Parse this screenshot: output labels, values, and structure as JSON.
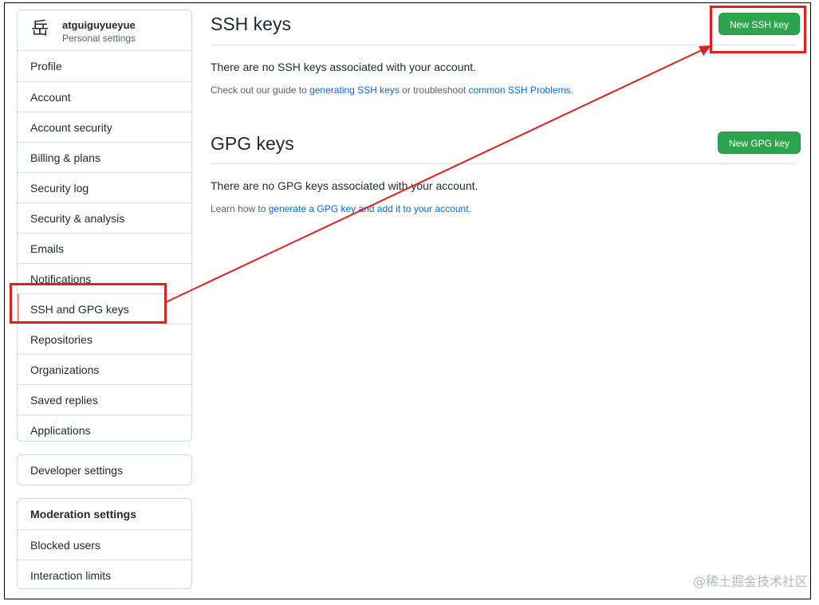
{
  "user": {
    "avatar_char": "岳",
    "name": "atguiguyueyue",
    "subtitle": "Personal settings"
  },
  "sidebar": {
    "items": [
      {
        "label": "Profile"
      },
      {
        "label": "Account"
      },
      {
        "label": "Account security"
      },
      {
        "label": "Billing & plans"
      },
      {
        "label": "Security log"
      },
      {
        "label": "Security & analysis"
      },
      {
        "label": "Emails"
      },
      {
        "label": "Notifications"
      },
      {
        "label": "SSH and GPG keys",
        "selected": true
      },
      {
        "label": "Repositories"
      },
      {
        "label": "Organizations"
      },
      {
        "label": "Saved replies"
      },
      {
        "label": "Applications"
      }
    ],
    "developer_settings": "Developer settings",
    "moderation": {
      "heading": "Moderation settings",
      "items": [
        {
          "label": "Blocked users"
        },
        {
          "label": "Interaction limits"
        }
      ]
    }
  },
  "ssh": {
    "title": "SSH keys",
    "button": "New SSH key",
    "empty_text": "There are no SSH keys associated with your account.",
    "note": {
      "prefix": "Check out our guide to ",
      "link1": "generating SSH keys",
      "middle": " or troubleshoot ",
      "link2": "common SSH Problems",
      "suffix": "."
    }
  },
  "gpg": {
    "title": "GPG keys",
    "button": "New GPG key",
    "empty_text": "There are no GPG keys associated with your account.",
    "note": {
      "prefix": "Learn how to ",
      "link1": "generate a GPG key and add it to your account",
      "suffix": "."
    }
  },
  "colors": {
    "accent_button": "#2da44e",
    "link": "#0969da",
    "annotation": "#e02020",
    "selected_indicator": "#fd8c73"
  },
  "watermark": "@稀土掘金技术社区"
}
